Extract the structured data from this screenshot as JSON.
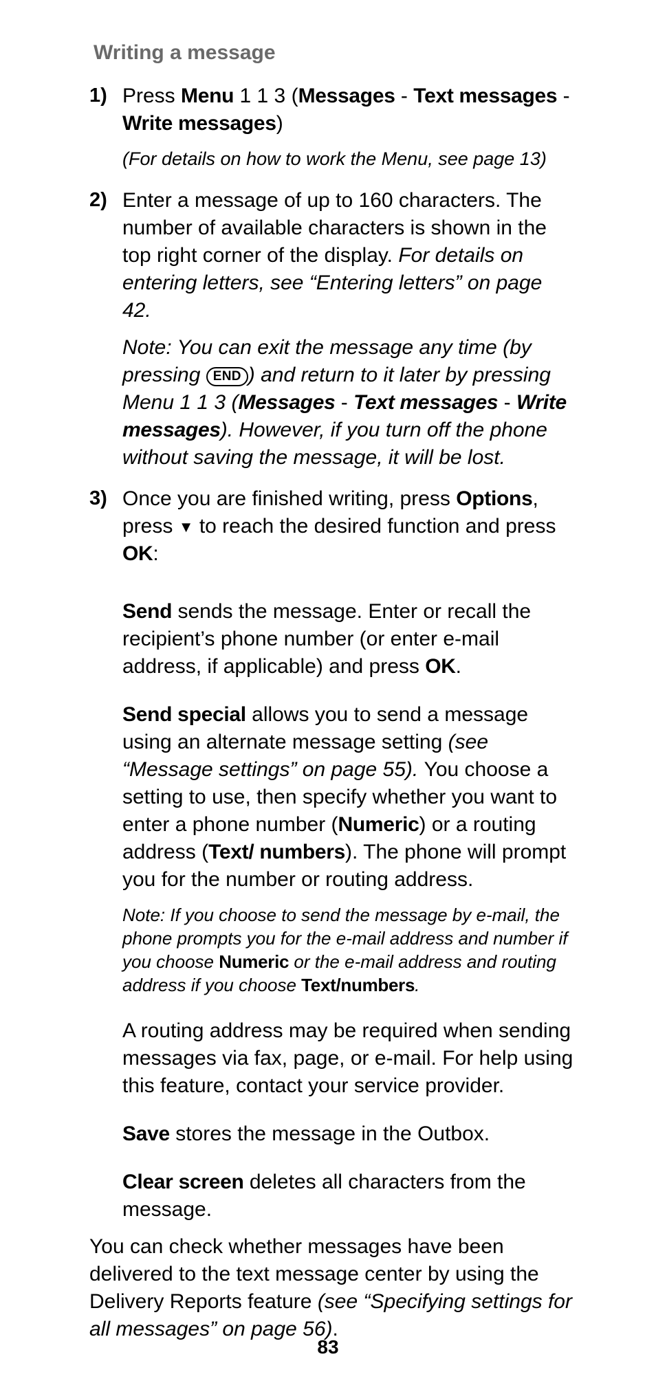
{
  "heading": "Writing a message",
  "steps": {
    "s1": {
      "num": "1)",
      "p1_a": "Press ",
      "p1_menu": "Menu",
      "p1_b": " 1 1 3 (",
      "p1_m1": "Messages",
      "p1_sep": " - ",
      "p1_m2": "Text messages",
      "p1_m3": "Write messages",
      "p1_c": ")",
      "note": "(For details on how to work the Menu, see page 13)"
    },
    "s2": {
      "num": "2)",
      "p1_a": "Enter a message of up to 160 characters. The number of available characters is shown in the top right corner of the display. ",
      "p1_i": "For details on entering letters, see “Entering letters” on page 42.",
      "n_a": "Note: You can exit the message any time (by pressing ",
      "n_end": "END",
      "n_b": ") and return to it later by pressing Menu 1 1 3 (",
      "n_m1": "Messages",
      "n_sep": " - ",
      "n_m2": "Text messages",
      "n_m3": "Write messages",
      "n_c": "). However, if you turn off the phone without saving the message, it will be lost."
    },
    "s3": {
      "num": "3)",
      "p1_a": "Once you are finished writing, press ",
      "p1_opt": "Options",
      "p1_b": ", press ",
      "p1_c": " to reach the desired function and press ",
      "p1_ok": "OK",
      "p1_d": ":",
      "send_lbl": "Send",
      "send_a": " sends the message. Enter or recall the recipient’s phone number (or enter e-mail address, if applicable) and press ",
      "send_ok": "OK",
      "send_b": ".",
      "ss_lbl": "Send special",
      "ss_a": " allows you to send a message using an alternate message setting ",
      "ss_i": "(see “Message set­tings” on page 55). ",
      "ss_b": "You choose a setting to use, then specify whether you want to enter a phone number (",
      "ss_num": "Numeric",
      "ss_c": ") or a routing address (",
      "ss_tn": "Text/ numbers",
      "ss_d": "). The phone will prompt you for the number or routing address.",
      "note2_a": "Note: If you choose to send the message by e-mail, the phone prompts you for the e-mail address and number if you choose ",
      "note2_num": "Numeric",
      "note2_b": " or the e-mail address and routing address if you choose ",
      "note2_tn": "Text/numbers",
      "note2_c": ".",
      "routing": "A routing address may be required when sending messages via fax, page, or e-mail. For help using this feature, contact your service provider.",
      "save_lbl": "Save",
      "save_txt": " stores the message in the Outbox.",
      "clr_lbl": "Clear screen",
      "clr_txt": " deletes all characters from the message."
    }
  },
  "closing_a": "You can check whether messages have been delivered to the text message center by using the Delivery Reports feature ",
  "closing_i": "(see “Specifying settings for all messages” on page 56)",
  "closing_b": ".",
  "page_number": "83"
}
